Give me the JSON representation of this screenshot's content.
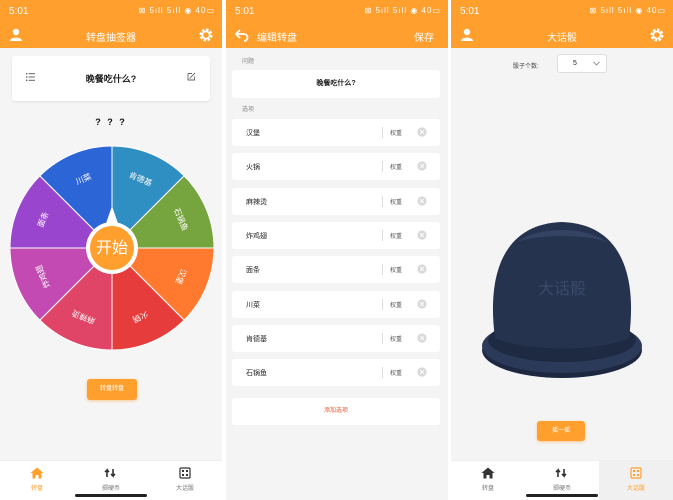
{
  "status": {
    "time": "5:01",
    "indicators": "⊠ 5ıll 5ıll ◉ 40▭"
  },
  "colors": {
    "accent": "#ff9f2e",
    "danger": "#e8552b"
  },
  "tabs": [
    {
      "label": "转盘",
      "icon": "home-icon"
    },
    {
      "label": "掷硬币",
      "icon": "coin-flip-icon"
    },
    {
      "label": "大话骰",
      "icon": "dice-icon"
    }
  ],
  "screen1": {
    "title": "转盘抽签器",
    "question": "晚餐吃什么?",
    "result": "? ? ?",
    "start_label": "开始",
    "switch_button": "转盘转盘",
    "wheel": {
      "segments": [
        {
          "label": "肯德基",
          "color": "#2f8ec2"
        },
        {
          "label": "石锅鱼",
          "color": "#76a53f"
        },
        {
          "label": "汉堡",
          "color": "#ff7a2e"
        },
        {
          "label": "火锅",
          "color": "#e63c3c"
        },
        {
          "label": "麻辣烫",
          "color": "#e04567"
        },
        {
          "label": "炸鸡翅",
          "color": "#c34ab3"
        },
        {
          "label": "面条",
          "color": "#9a45cd"
        },
        {
          "label": "川菜",
          "color": "#2c66d6"
        }
      ]
    }
  },
  "screen2": {
    "title": "编辑转盘",
    "save": "保存",
    "question_label": "问题",
    "question": "晚餐吃什么?",
    "options_label": "选项",
    "weight_label": "权重",
    "options": [
      "汉堡",
      "火锅",
      "麻辣烫",
      "炸鸡翅",
      "面条",
      "川菜",
      "肯德基",
      "石锅鱼"
    ],
    "add_option": "添加选项"
  },
  "screen3": {
    "title": "大话骰",
    "dice_count_label": "骰子个数:",
    "dice_count_value": "5",
    "cup_text": "大话骰",
    "shake_button": "摇一摇"
  }
}
